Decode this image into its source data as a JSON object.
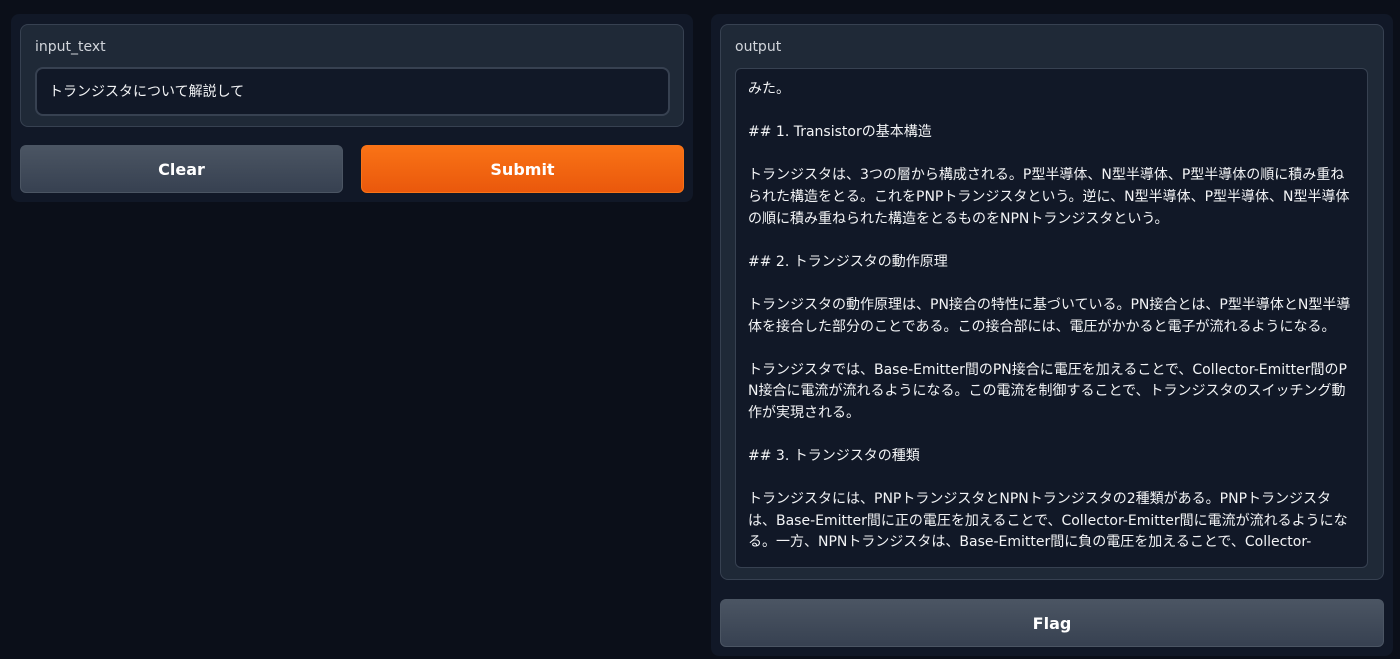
{
  "input": {
    "label": "input_text",
    "value": "トランジスタについて解説して"
  },
  "buttons": {
    "clear_label": "Clear",
    "submit_label": "Submit",
    "flag_label": "Flag"
  },
  "output": {
    "label": "output",
    "text": "みた。\n\n## 1. Transistorの基本構造\n\nトランジスタは、3つの層から構成される。P型半導体、N型半導体、P型半導体の順に積み重ねられた構造をとる。これをPNPトランジスタという。逆に、N型半導体、P型半導体、N型半導体の順に積み重ねられた構造をとるものをNPNトランジスタという。\n\n## 2. トランジスタの動作原理\n\nトランジスタの動作原理は、PN接合の特性に基づいている。PN接合とは、P型半導体とN型半導体を接合した部分のことである。この接合部には、電圧がかかると電子が流れるようになる。\n\nトランジスタでは、Base-Emitter間のPN接合に電圧を加えることで、Collector-Emitter間のPN接合に電流が流れるようになる。この電流を制御することで、トランジスタのスイッチング動作が実現される。\n\n## 3. トランジスタの種類\n\nトランジスタには、PNPトランジスタとNPNトランジスタの2種類がある。PNPトランジスタは、Base-Emitter間に正の電圧を加えることで、Collector-Emitter間に電流が流れるようになる。一方、NPNトランジスタは、Base-Emitter間に負の電圧を加えることで、Collector-"
  },
  "colors": {
    "background": "#0b0f19",
    "panel": "#1f2937",
    "primary": "#f97316",
    "secondary": "#4b5563"
  }
}
